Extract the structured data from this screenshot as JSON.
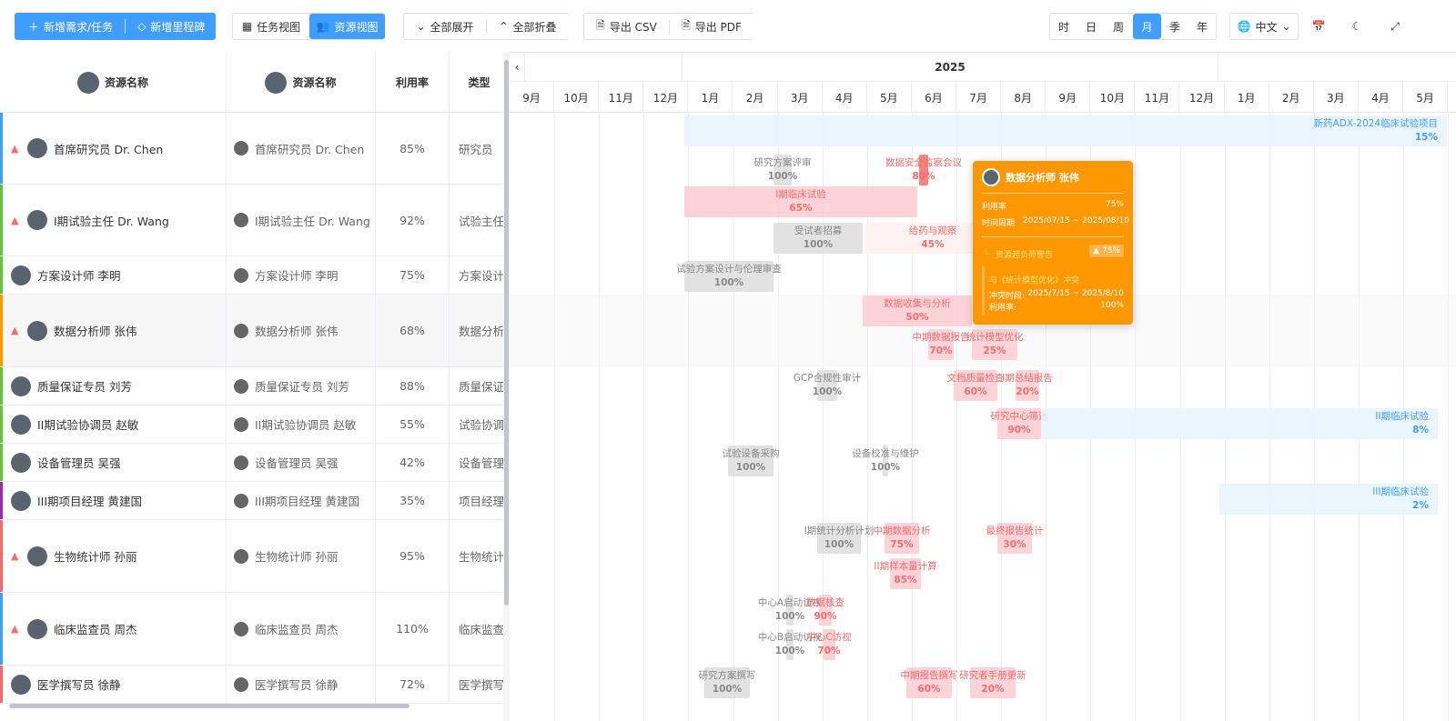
{
  "toolbar": {
    "add_task": "新增需求/任务",
    "add_milestone": "新增里程碑",
    "task_view": "任务视图",
    "resource_view": "资源视图",
    "expand_all": "全部展开",
    "collapse_all": "全部折叠",
    "export_csv": "导出 CSV",
    "export_pdf": "导出 PDF",
    "scales": [
      "时",
      "日",
      "周",
      "月",
      "季",
      "年"
    ],
    "active_scale": "月",
    "language": "中文"
  },
  "columns": {
    "name1": "资源名称",
    "name2": "资源名称",
    "util": "利用率",
    "type": "类型"
  },
  "rows": [
    {
      "name": "首席研究员 Dr. Chen",
      "util": "85%",
      "type": "研究员",
      "warn": true,
      "color": "#409eff"
    },
    {
      "name": "I期试验主任 Dr. Wang",
      "util": "92%",
      "type": "试验主任",
      "warn": true,
      "color": "#67c23a"
    },
    {
      "name": "方案设计师 李明",
      "util": "75%",
      "type": "方案设计",
      "warn": false,
      "color": "#67c23a"
    },
    {
      "name": "数据分析师 张伟",
      "util": "68%",
      "type": "数据分析",
      "warn": true,
      "color": "#ff9800"
    },
    {
      "name": "质量保证专员 刘芳",
      "util": "88%",
      "type": "质量保证",
      "warn": false,
      "color": "#67c23a"
    },
    {
      "name": "II期试验协调员 赵敏",
      "util": "55%",
      "type": "试验协调",
      "warn": false,
      "color": "#67c23a"
    },
    {
      "name": "设备管理员 吴强",
      "util": "42%",
      "type": "设备管理",
      "warn": false,
      "color": "#67c23a"
    },
    {
      "name": "III期项目经理 黄建国",
      "util": "35%",
      "type": "项目经理",
      "warn": false,
      "color": "#9c27b0"
    },
    {
      "name": "生物统计师 孙丽",
      "util": "95%",
      "type": "生物统计",
      "warn": true,
      "color": "#f56c6c"
    },
    {
      "name": "临床监查员 周杰",
      "util": "110%",
      "type": "临床监查",
      "warn": true,
      "color": "#409eff"
    },
    {
      "name": "医学撰写员 徐静",
      "util": "72%",
      "type": "医学撰写",
      "warn": false,
      "color": "#f56c6c"
    }
  ],
  "timeline": {
    "year": "2025",
    "months": [
      "9月",
      "10月",
      "11月",
      "12月",
      "1月",
      "2月",
      "3月",
      "4月",
      "5月",
      "6月",
      "7月",
      "8月",
      "9月",
      "10月",
      "11月",
      "12月",
      "1月",
      "2月",
      "3月",
      "4月",
      "5月"
    ]
  },
  "tasks": [
    {
      "name": "新药ADX-2024临床试验项目",
      "pct": "15%"
    },
    {
      "name": "研究方案评审",
      "pct": "100%"
    },
    {
      "name": "数据安全监察会议",
      "pct": "80%"
    },
    {
      "name": "I期临床试验",
      "pct": "65%"
    },
    {
      "name": "受试者招募",
      "pct": "100%"
    },
    {
      "name": "给药与观察",
      "pct": "45%"
    },
    {
      "name": "试验方案设计与伦理审查",
      "pct": "100%"
    },
    {
      "name": "数据收集与分析",
      "pct": "50%"
    },
    {
      "name": "中期数据报告",
      "pct": "70%"
    },
    {
      "name": "统计模型优化",
      "pct": "25%"
    },
    {
      "name": "GCP合规性审计",
      "pct": "100%"
    },
    {
      "name": "文档质量检查",
      "pct": "60%"
    },
    {
      "name": "I期总结报告",
      "pct": "20%"
    },
    {
      "name": "研究中心筛选",
      "pct": "90%"
    },
    {
      "name": "II期临床试验",
      "pct": "8%"
    },
    {
      "name": "试验设备采购",
      "pct": "100%"
    },
    {
      "name": "设备校准与维护",
      "pct": "100%"
    },
    {
      "name": "III期临床试验",
      "pct": "2%"
    },
    {
      "name": "I期统计分析计划",
      "pct": "100%"
    },
    {
      "name": "中期数据分析",
      "pct": "75%"
    },
    {
      "name": "最终报告统计",
      "pct": "30%"
    },
    {
      "name": "II期样本量计算",
      "pct": "85%"
    },
    {
      "name": "中心A启动访视",
      "pct": "100%"
    },
    {
      "name": "数据核查",
      "pct": "90%"
    },
    {
      "name": "中心B启动访视",
      "pct": "100%"
    },
    {
      "name": "中心C访视",
      "pct": "70%"
    },
    {
      "name": "研究方案撰写",
      "pct": "100%"
    },
    {
      "name": "中期报告撰写",
      "pct": "60%"
    },
    {
      "name": "研究者手册更新",
      "pct": "20%"
    }
  ],
  "tooltip": {
    "title": "数据分析师 张伟",
    "util_label": "利用率",
    "util_value": "75%",
    "period_label": "时间周期",
    "period_value": "2025/07/15 ~ 2025/08/10",
    "conflict_title": "资源超负荷警告",
    "conflict_badge": "▲ 75%",
    "conflict_with": "与《统计模型优化》冲突",
    "conflict_period_label": "冲突时段:",
    "conflict_period": "2025/7/15 ~ 2025/8/10",
    "conflict_util_label": "利用率:",
    "conflict_util": "100%"
  }
}
